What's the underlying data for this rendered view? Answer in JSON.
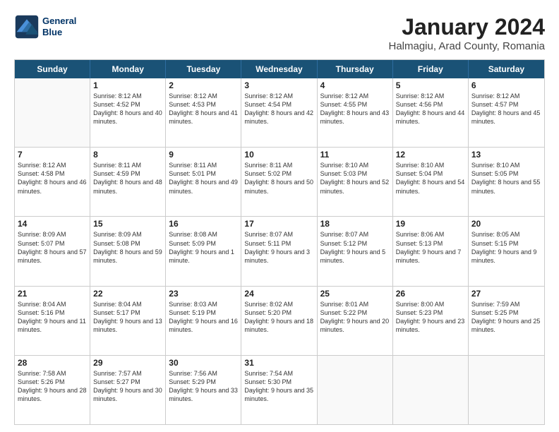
{
  "header": {
    "logo_line1": "General",
    "logo_line2": "Blue",
    "title": "January 2024",
    "subtitle": "Halmagiu, Arad County, Romania"
  },
  "day_names": [
    "Sunday",
    "Monday",
    "Tuesday",
    "Wednesday",
    "Thursday",
    "Friday",
    "Saturday"
  ],
  "rows": [
    [
      {
        "day": "",
        "sunrise": "",
        "sunset": "",
        "daylight": ""
      },
      {
        "day": "1",
        "sunrise": "Sunrise: 8:12 AM",
        "sunset": "Sunset: 4:52 PM",
        "daylight": "Daylight: 8 hours and 40 minutes."
      },
      {
        "day": "2",
        "sunrise": "Sunrise: 8:12 AM",
        "sunset": "Sunset: 4:53 PM",
        "daylight": "Daylight: 8 hours and 41 minutes."
      },
      {
        "day": "3",
        "sunrise": "Sunrise: 8:12 AM",
        "sunset": "Sunset: 4:54 PM",
        "daylight": "Daylight: 8 hours and 42 minutes."
      },
      {
        "day": "4",
        "sunrise": "Sunrise: 8:12 AM",
        "sunset": "Sunset: 4:55 PM",
        "daylight": "Daylight: 8 hours and 43 minutes."
      },
      {
        "day": "5",
        "sunrise": "Sunrise: 8:12 AM",
        "sunset": "Sunset: 4:56 PM",
        "daylight": "Daylight: 8 hours and 44 minutes."
      },
      {
        "day": "6",
        "sunrise": "Sunrise: 8:12 AM",
        "sunset": "Sunset: 4:57 PM",
        "daylight": "Daylight: 8 hours and 45 minutes."
      }
    ],
    [
      {
        "day": "7",
        "sunrise": "Sunrise: 8:12 AM",
        "sunset": "Sunset: 4:58 PM",
        "daylight": "Daylight: 8 hours and 46 minutes."
      },
      {
        "day": "8",
        "sunrise": "Sunrise: 8:11 AM",
        "sunset": "Sunset: 4:59 PM",
        "daylight": "Daylight: 8 hours and 48 minutes."
      },
      {
        "day": "9",
        "sunrise": "Sunrise: 8:11 AM",
        "sunset": "Sunset: 5:01 PM",
        "daylight": "Daylight: 8 hours and 49 minutes."
      },
      {
        "day": "10",
        "sunrise": "Sunrise: 8:11 AM",
        "sunset": "Sunset: 5:02 PM",
        "daylight": "Daylight: 8 hours and 50 minutes."
      },
      {
        "day": "11",
        "sunrise": "Sunrise: 8:10 AM",
        "sunset": "Sunset: 5:03 PM",
        "daylight": "Daylight: 8 hours and 52 minutes."
      },
      {
        "day": "12",
        "sunrise": "Sunrise: 8:10 AM",
        "sunset": "Sunset: 5:04 PM",
        "daylight": "Daylight: 8 hours and 54 minutes."
      },
      {
        "day": "13",
        "sunrise": "Sunrise: 8:10 AM",
        "sunset": "Sunset: 5:05 PM",
        "daylight": "Daylight: 8 hours and 55 minutes."
      }
    ],
    [
      {
        "day": "14",
        "sunrise": "Sunrise: 8:09 AM",
        "sunset": "Sunset: 5:07 PM",
        "daylight": "Daylight: 8 hours and 57 minutes."
      },
      {
        "day": "15",
        "sunrise": "Sunrise: 8:09 AM",
        "sunset": "Sunset: 5:08 PM",
        "daylight": "Daylight: 8 hours and 59 minutes."
      },
      {
        "day": "16",
        "sunrise": "Sunrise: 8:08 AM",
        "sunset": "Sunset: 5:09 PM",
        "daylight": "Daylight: 9 hours and 1 minute."
      },
      {
        "day": "17",
        "sunrise": "Sunrise: 8:07 AM",
        "sunset": "Sunset: 5:11 PM",
        "daylight": "Daylight: 9 hours and 3 minutes."
      },
      {
        "day": "18",
        "sunrise": "Sunrise: 8:07 AM",
        "sunset": "Sunset: 5:12 PM",
        "daylight": "Daylight: 9 hours and 5 minutes."
      },
      {
        "day": "19",
        "sunrise": "Sunrise: 8:06 AM",
        "sunset": "Sunset: 5:13 PM",
        "daylight": "Daylight: 9 hours and 7 minutes."
      },
      {
        "day": "20",
        "sunrise": "Sunrise: 8:05 AM",
        "sunset": "Sunset: 5:15 PM",
        "daylight": "Daylight: 9 hours and 9 minutes."
      }
    ],
    [
      {
        "day": "21",
        "sunrise": "Sunrise: 8:04 AM",
        "sunset": "Sunset: 5:16 PM",
        "daylight": "Daylight: 9 hours and 11 minutes."
      },
      {
        "day": "22",
        "sunrise": "Sunrise: 8:04 AM",
        "sunset": "Sunset: 5:17 PM",
        "daylight": "Daylight: 9 hours and 13 minutes."
      },
      {
        "day": "23",
        "sunrise": "Sunrise: 8:03 AM",
        "sunset": "Sunset: 5:19 PM",
        "daylight": "Daylight: 9 hours and 16 minutes."
      },
      {
        "day": "24",
        "sunrise": "Sunrise: 8:02 AM",
        "sunset": "Sunset: 5:20 PM",
        "daylight": "Daylight: 9 hours and 18 minutes."
      },
      {
        "day": "25",
        "sunrise": "Sunrise: 8:01 AM",
        "sunset": "Sunset: 5:22 PM",
        "daylight": "Daylight: 9 hours and 20 minutes."
      },
      {
        "day": "26",
        "sunrise": "Sunrise: 8:00 AM",
        "sunset": "Sunset: 5:23 PM",
        "daylight": "Daylight: 9 hours and 23 minutes."
      },
      {
        "day": "27",
        "sunrise": "Sunrise: 7:59 AM",
        "sunset": "Sunset: 5:25 PM",
        "daylight": "Daylight: 9 hours and 25 minutes."
      }
    ],
    [
      {
        "day": "28",
        "sunrise": "Sunrise: 7:58 AM",
        "sunset": "Sunset: 5:26 PM",
        "daylight": "Daylight: 9 hours and 28 minutes."
      },
      {
        "day": "29",
        "sunrise": "Sunrise: 7:57 AM",
        "sunset": "Sunset: 5:27 PM",
        "daylight": "Daylight: 9 hours and 30 minutes."
      },
      {
        "day": "30",
        "sunrise": "Sunrise: 7:56 AM",
        "sunset": "Sunset: 5:29 PM",
        "daylight": "Daylight: 9 hours and 33 minutes."
      },
      {
        "day": "31",
        "sunrise": "Sunrise: 7:54 AM",
        "sunset": "Sunset: 5:30 PM",
        "daylight": "Daylight: 9 hours and 35 minutes."
      },
      {
        "day": "",
        "sunrise": "",
        "sunset": "",
        "daylight": ""
      },
      {
        "day": "",
        "sunrise": "",
        "sunset": "",
        "daylight": ""
      },
      {
        "day": "",
        "sunrise": "",
        "sunset": "",
        "daylight": ""
      }
    ]
  ]
}
